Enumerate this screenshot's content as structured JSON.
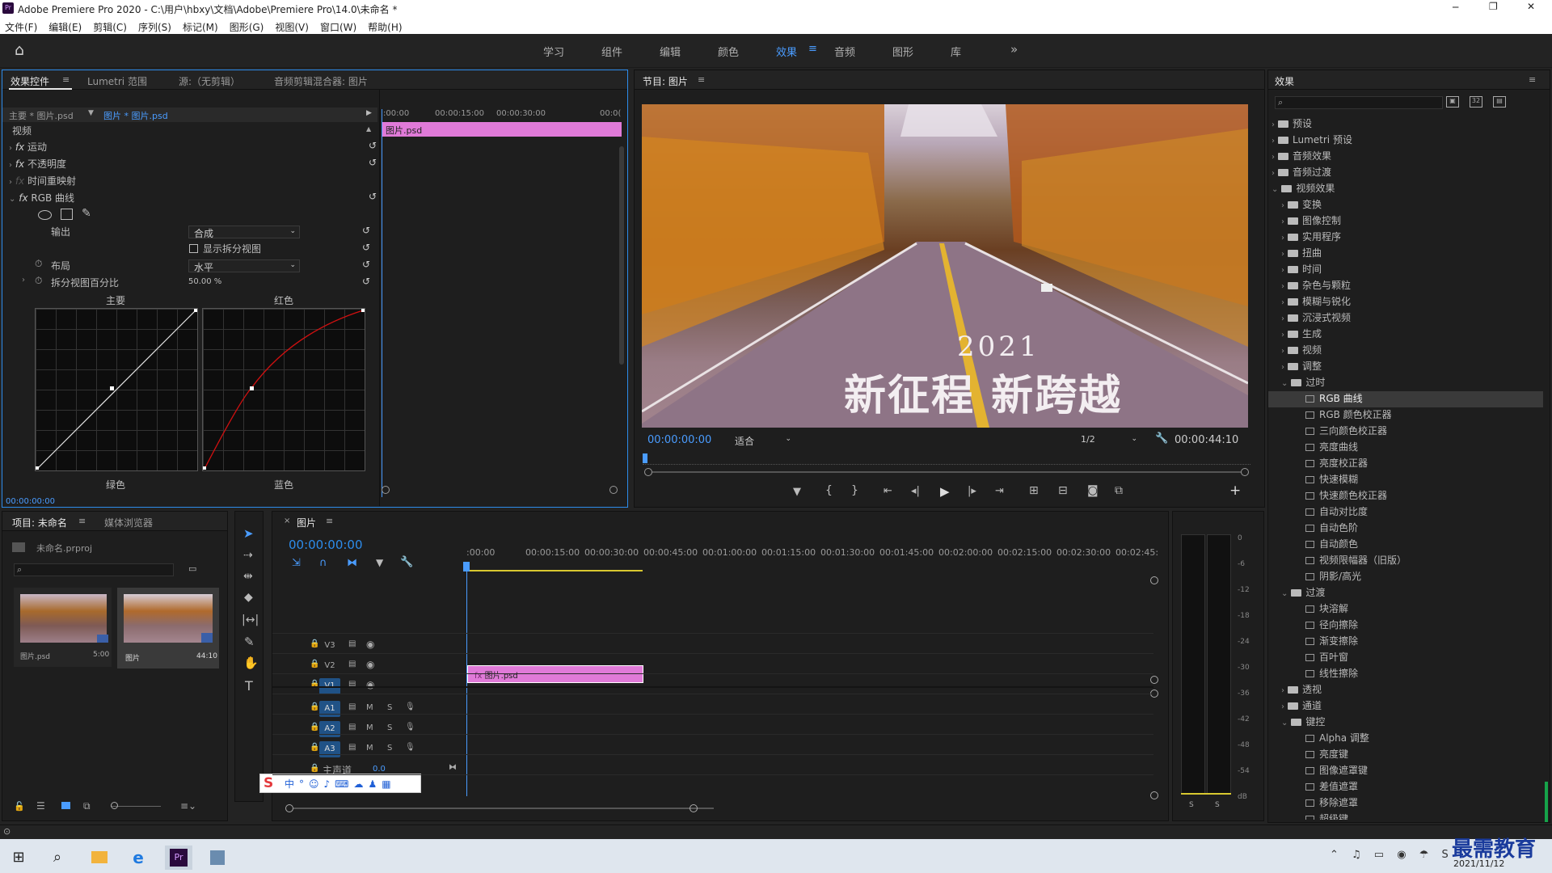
{
  "window": {
    "title": "Adobe Premiere Pro 2020 - C:\\用户\\hbxy\\文档\\Adobe\\Premiere Pro\\14.0\\未命名 *",
    "minimize": "─",
    "maximize": "❐",
    "close": "✕"
  },
  "menu": [
    "文件(F)",
    "编辑(E)",
    "剪辑(C)",
    "序列(S)",
    "标记(M)",
    "图形(G)",
    "视图(V)",
    "窗口(W)",
    "帮助(H)"
  ],
  "workspaces": [
    "学习",
    "组件",
    "编辑",
    "颜色",
    "效果",
    "音频",
    "图形",
    "库"
  ],
  "active_workspace": "效果",
  "effect_controls": {
    "tabs": [
      "效果控件",
      "Lumetri 范围",
      "源:（无剪辑）",
      "音频剪辑混合器: 图片"
    ],
    "master_label": "主要 * 图片.psd",
    "clip_label": "图片 * 图片.psd",
    "section": "视频",
    "effects": [
      "运动",
      "不透明度",
      "时间重映射",
      "RGB 曲线"
    ],
    "output_label": "输出",
    "output_value": "合成",
    "split_label": "显示拆分视图",
    "layout_label": "布局",
    "layout_value": "水平",
    "split_pct_label": "拆分视图百分比",
    "split_pct_value": "50.00 %",
    "curve_labels": [
      "主要",
      "红色",
      "绿色",
      "蓝色"
    ],
    "ruler": [
      ":00:00",
      "00:00:15:00",
      "00:00:30:00",
      "00:0("
    ],
    "clip_name": "图片.psd",
    "timecode": "00:00:00:00"
  },
  "program": {
    "title": "节目: 图片",
    "overlay_line1": "2021",
    "overlay_line2": "新征程 新跨越",
    "timecode": "00:00:00:00",
    "fit": "适合",
    "resolution": "1/2",
    "duration": "00:00:44:10"
  },
  "effects_panel": {
    "title": "效果",
    "items": [
      {
        "label": "预设",
        "level": 0,
        "open": false,
        "type": "folder"
      },
      {
        "label": "Lumetri 预设",
        "level": 0,
        "open": false,
        "type": "folder"
      },
      {
        "label": "音频效果",
        "level": 0,
        "open": false,
        "type": "folder"
      },
      {
        "label": "音频过渡",
        "level": 0,
        "open": false,
        "type": "folder"
      },
      {
        "label": "视频效果",
        "level": 0,
        "open": true,
        "type": "folder"
      },
      {
        "label": "变换",
        "level": 1,
        "open": false,
        "type": "folder"
      },
      {
        "label": "图像控制",
        "level": 1,
        "open": false,
        "type": "folder"
      },
      {
        "label": "实用程序",
        "level": 1,
        "open": false,
        "type": "folder"
      },
      {
        "label": "扭曲",
        "level": 1,
        "open": false,
        "type": "folder"
      },
      {
        "label": "时间",
        "level": 1,
        "open": false,
        "type": "folder"
      },
      {
        "label": "杂色与颗粒",
        "level": 1,
        "open": false,
        "type": "folder"
      },
      {
        "label": "模糊与锐化",
        "level": 1,
        "open": false,
        "type": "folder"
      },
      {
        "label": "沉浸式视频",
        "level": 1,
        "open": false,
        "type": "folder"
      },
      {
        "label": "生成",
        "level": 1,
        "open": false,
        "type": "folder"
      },
      {
        "label": "视频",
        "level": 1,
        "open": false,
        "type": "folder"
      },
      {
        "label": "调整",
        "level": 1,
        "open": false,
        "type": "folder"
      },
      {
        "label": "过时",
        "level": 1,
        "open": true,
        "type": "folder"
      },
      {
        "label": "RGB 曲线",
        "level": 2,
        "type": "fx",
        "selected": true
      },
      {
        "label": "RGB 颜色校正器",
        "level": 2,
        "type": "fx"
      },
      {
        "label": "三向颜色校正器",
        "level": 2,
        "type": "fx"
      },
      {
        "label": "亮度曲线",
        "level": 2,
        "type": "fx"
      },
      {
        "label": "亮度校正器",
        "level": 2,
        "type": "fx"
      },
      {
        "label": "快速模糊",
        "level": 2,
        "type": "fx"
      },
      {
        "label": "快速颜色校正器",
        "level": 2,
        "type": "fx"
      },
      {
        "label": "自动对比度",
        "level": 2,
        "type": "fx"
      },
      {
        "label": "自动色阶",
        "level": 2,
        "type": "fx"
      },
      {
        "label": "自动颜色",
        "level": 2,
        "type": "fx"
      },
      {
        "label": "视频限幅器（旧版）",
        "level": 2,
        "type": "fx"
      },
      {
        "label": "阴影/高光",
        "level": 2,
        "type": "fx"
      },
      {
        "label": "过渡",
        "level": 1,
        "open": true,
        "type": "folder"
      },
      {
        "label": "块溶解",
        "level": 2,
        "type": "fx"
      },
      {
        "label": "径向擦除",
        "level": 2,
        "type": "fx"
      },
      {
        "label": "渐变擦除",
        "level": 2,
        "type": "fx"
      },
      {
        "label": "百叶窗",
        "level": 2,
        "type": "fx"
      },
      {
        "label": "线性擦除",
        "level": 2,
        "type": "fx"
      },
      {
        "label": "透视",
        "level": 1,
        "open": false,
        "type": "folder"
      },
      {
        "label": "通道",
        "level": 1,
        "open": false,
        "type": "folder"
      },
      {
        "label": "键控",
        "level": 1,
        "open": true,
        "type": "folder"
      },
      {
        "label": "Alpha 调整",
        "level": 2,
        "type": "fx"
      },
      {
        "label": "亮度键",
        "level": 2,
        "type": "fx"
      },
      {
        "label": "图像遮罩键",
        "level": 2,
        "type": "fx"
      },
      {
        "label": "差值遮罩",
        "level": 2,
        "type": "fx"
      },
      {
        "label": "移除遮罩",
        "level": 2,
        "type": "fx"
      },
      {
        "label": "超级键",
        "level": 2,
        "type": "fx"
      }
    ]
  },
  "project": {
    "tabs": [
      "项目: 未命名",
      "媒体浏览器"
    ],
    "file": "未命名.prproj",
    "items": [
      {
        "name": "图片.psd",
        "dur": "5:00"
      },
      {
        "name": "图片",
        "dur": "44:10"
      }
    ]
  },
  "timeline": {
    "title": "图片",
    "timecode": "00:00:00:00",
    "ruler": [
      ":00:00",
      "00:00:15:00",
      "00:00:30:00",
      "00:00:45:00",
      "00:01:00:00",
      "00:01:15:00",
      "00:01:30:00",
      "00:01:45:00",
      "00:02:00:00",
      "00:02:15:00",
      "00:02:30:00",
      "00:02:45:"
    ],
    "video_tracks": [
      "V3",
      "V2",
      "V1"
    ],
    "audio_tracks": [
      "A1",
      "A2",
      "A3"
    ],
    "master": "主声道",
    "master_value": "0.0",
    "clip": "图片.psd",
    "m": "M",
    "s": "S"
  },
  "meter": {
    "scale": [
      "0",
      "-6",
      "-12",
      "-18",
      "-24",
      "-30",
      "-36",
      "-42",
      "-48",
      "-54",
      "dB"
    ],
    "solo": [
      "S",
      "S"
    ]
  },
  "taskbar": {
    "date": "2021/11/12",
    "watermark": "最需教育"
  },
  "colors": {
    "accent": "#2d8ceb",
    "clip": "#e07ad8",
    "bg": "#1e1e1e"
  }
}
